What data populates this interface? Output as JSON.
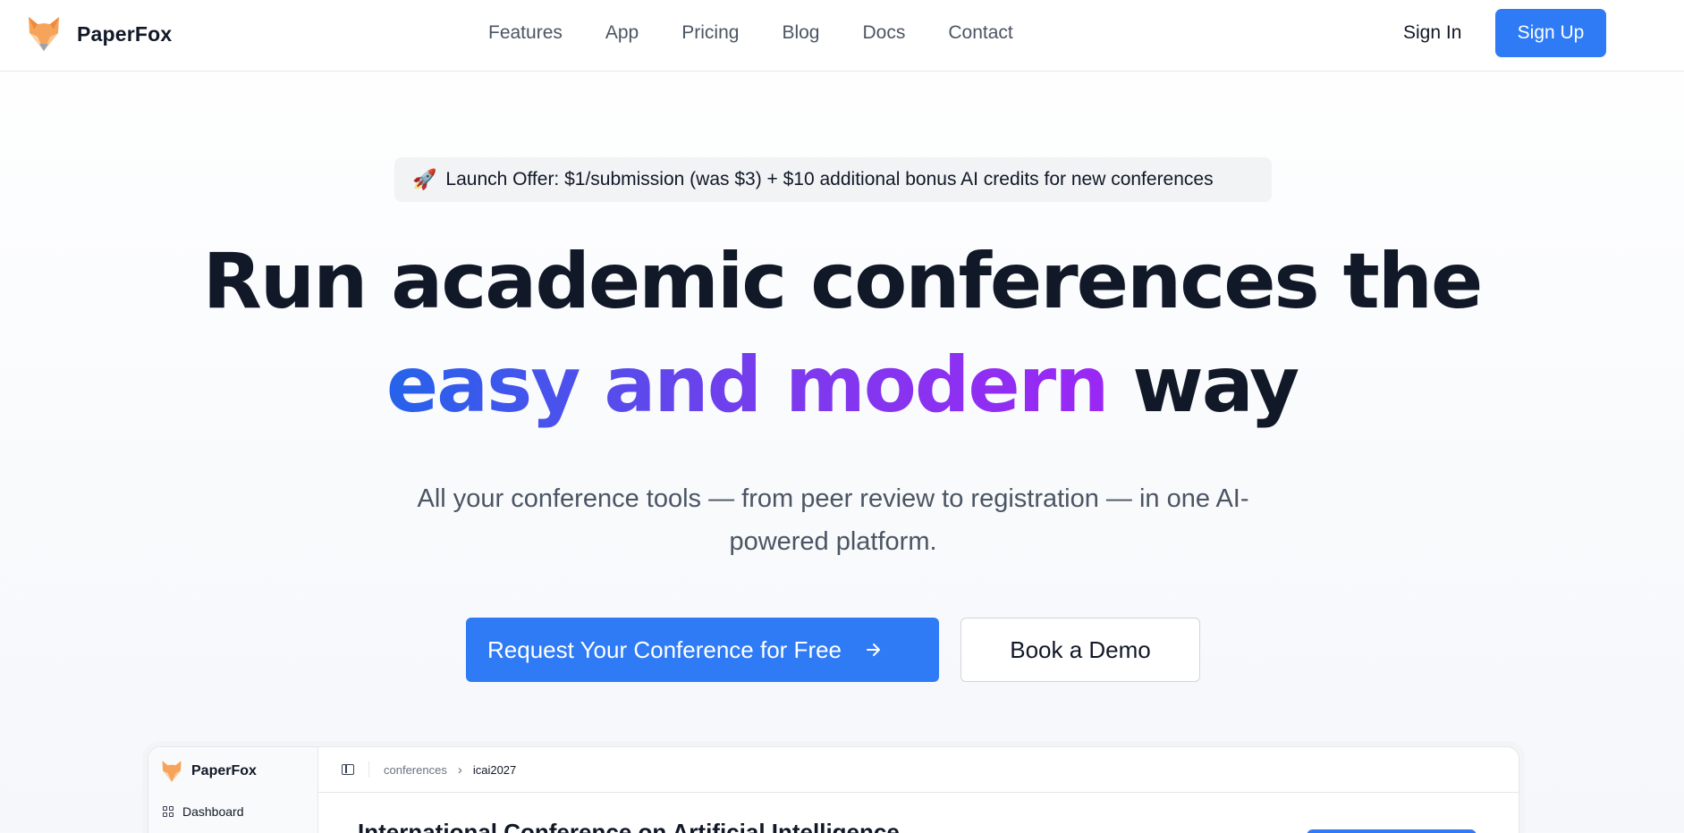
{
  "brand": {
    "name": "PaperFox"
  },
  "nav": {
    "items": [
      "Features",
      "App",
      "Pricing",
      "Blog",
      "Docs",
      "Contact"
    ],
    "sign_in": "Sign In",
    "sign_up": "Sign Up"
  },
  "hero": {
    "offer": {
      "icon": "rocket-emoji",
      "text": "Launch Offer: $1/submission (was $3) + $10 additional bonus AI credits for new conferences"
    },
    "headline_line1": "Run academic conferences the",
    "headline_highlight": "easy and modern",
    "headline_end": " way",
    "subtitle": "All your conference tools — from peer review to registration — in one AI-powered platform.",
    "cta_primary": "Request Your Conference for Free",
    "cta_primary_icon": "arrow-right-icon",
    "cta_secondary": "Book a Demo"
  },
  "preview": {
    "brand": "PaperFox",
    "sidebar": {
      "dashboard": "Dashboard"
    },
    "breadcrumb": [
      "conferences",
      "icai2027"
    ],
    "title": "International Conference on Artificial Intelligence"
  },
  "colors": {
    "accent": "#2f7bf5",
    "gradient_start": "#2563eb",
    "gradient_end": "#9b27f5",
    "fox_orange": "#f6a35b"
  }
}
